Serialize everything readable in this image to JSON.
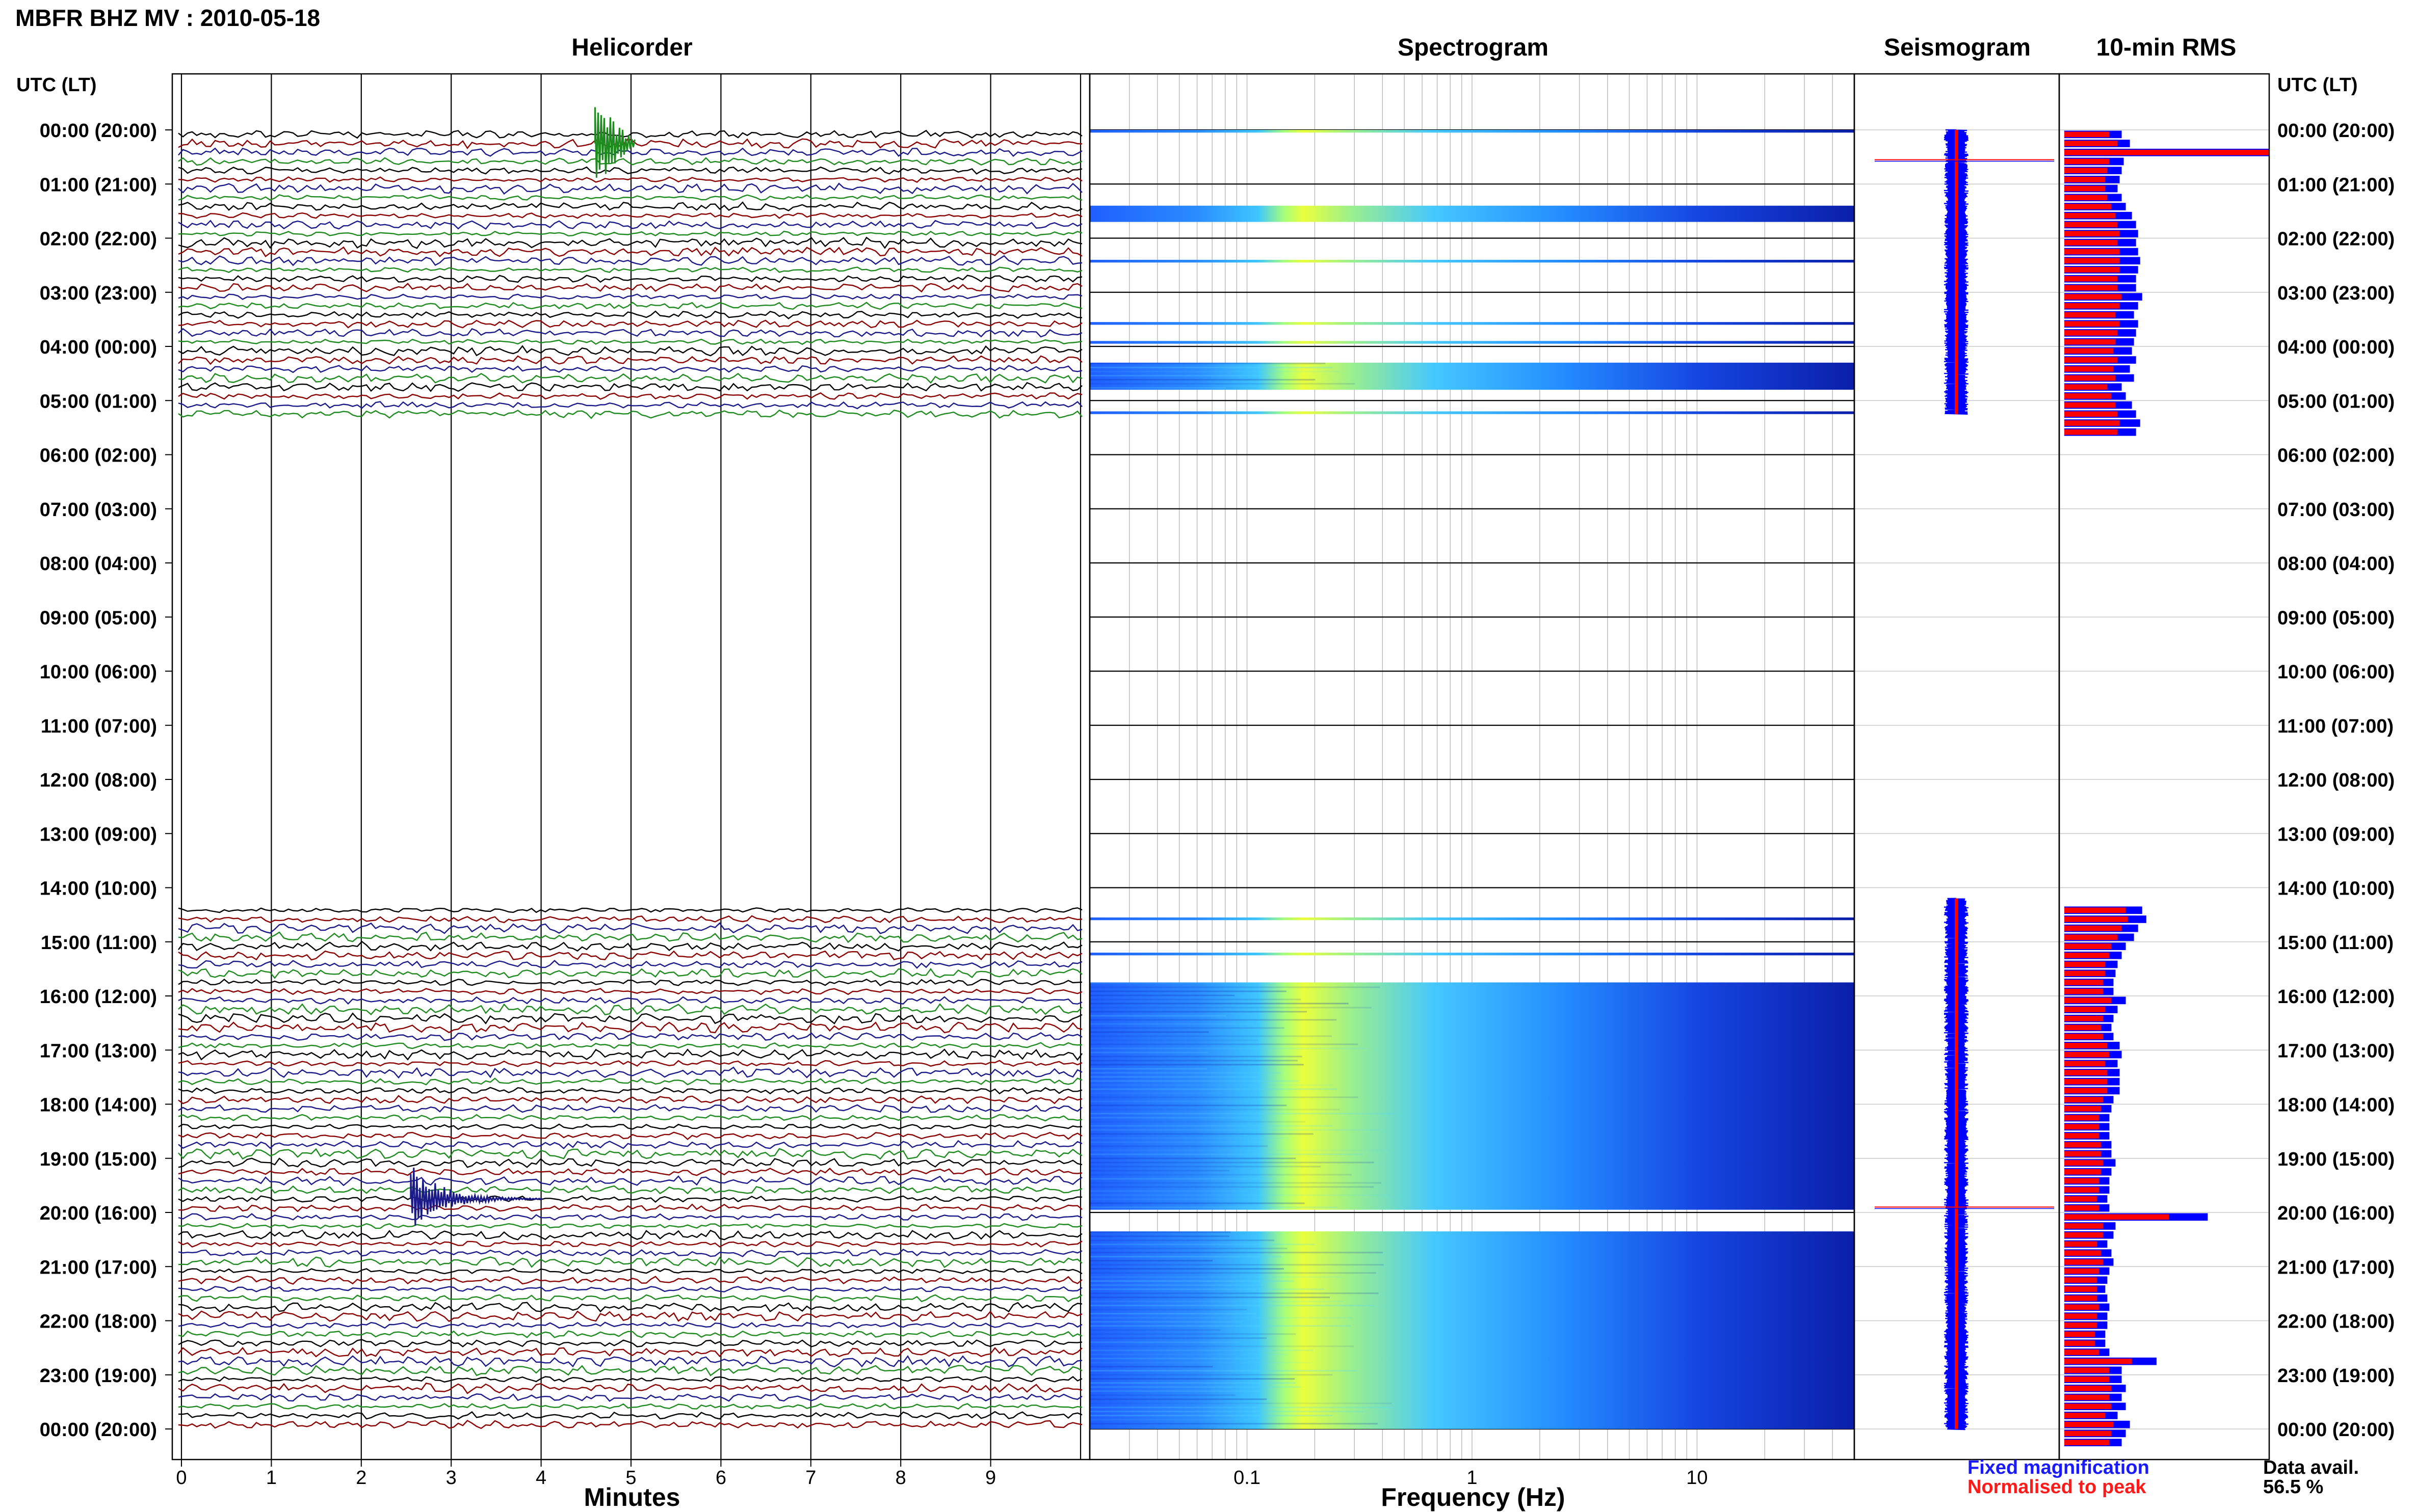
{
  "title": "MBFR BHZ MV : 2010-05-18",
  "panels": {
    "helicorder": "Helicorder",
    "spectrogram": "Spectrogram",
    "seismogram": "Seismogram",
    "rms": "10-min RMS"
  },
  "axis_titles": {
    "minutes": "Minutes",
    "frequency": "Frequency (Hz)"
  },
  "time_axis_label": "UTC (LT)",
  "legend": {
    "fixed": "Fixed magnification",
    "normalised": "Normalised to peak"
  },
  "data_availability": {
    "label": "Data avail.",
    "value": "56.5 %"
  },
  "colors": {
    "trace_cycle": [
      "#000000",
      "#8b0000",
      "#1a1a8b",
      "#1e8b1e"
    ],
    "fixed_magnification": "#0000ff",
    "normalised_to_peak": "#ff0000"
  },
  "chart_data": {
    "type": "line",
    "station": "MBFR",
    "channel": "BHZ",
    "network": "MV",
    "date": "2010-05-18",
    "time_ticks": [
      "00:00 (20:00)",
      "01:00 (21:00)",
      "02:00 (22:00)",
      "03:00 (23:00)",
      "04:00 (00:00)",
      "05:00 (01:00)",
      "06:00 (02:00)",
      "07:00 (03:00)",
      "08:00 (04:00)",
      "09:00 (05:00)",
      "10:00 (06:00)",
      "11:00 (07:00)",
      "12:00 (08:00)",
      "13:00 (09:00)",
      "14:00 (10:00)",
      "15:00 (11:00)",
      "16:00 (12:00)",
      "17:00 (13:00)",
      "18:00 (14:00)",
      "19:00 (15:00)",
      "20:00 (16:00)",
      "21:00 (17:00)",
      "22:00 (18:00)",
      "23:00 (19:00)",
      "00:00 (20:00)"
    ],
    "helicorder": {
      "x_ticks": [
        "0",
        "1",
        "2",
        "3",
        "4",
        "5",
        "6",
        "7",
        "8",
        "9"
      ],
      "xlim": [
        0,
        10
      ],
      "rows_per_hour": 6,
      "data_spans_utc_hours": [
        [
          0.0,
          5.25
        ],
        [
          14.2,
          24.0
        ]
      ],
      "events": [
        {
          "hour": 0.25,
          "minute": 4.6,
          "label": "burst"
        },
        {
          "hour": 19.75,
          "minute": 2.55,
          "label": "earthquake"
        }
      ]
    },
    "spectrogram": {
      "scale": "log",
      "xlim": [
        0.02,
        50
      ],
      "x_ticks": [
        "0.1",
        "1",
        "10"
      ],
      "data_spans_utc_hours": [
        [
          0.0,
          0.05
        ],
        [
          1.4,
          1.7
        ],
        [
          2.4,
          2.45
        ],
        [
          3.55,
          3.6
        ],
        [
          3.9,
          3.95
        ],
        [
          4.3,
          4.8
        ],
        [
          5.2,
          5.25
        ],
        [
          14.55,
          14.6
        ],
        [
          15.2,
          15.25
        ],
        [
          15.75,
          19.95
        ],
        [
          20.35,
          24.0
        ]
      ]
    },
    "seismogram": {
      "spikes_utc_hours": [
        0.55,
        19.9
      ]
    },
    "rms_10min": {
      "xlim": [
        0,
        100
      ],
      "series": [
        {
          "name": "Fixed magnification",
          "color": "#0000ff",
          "values": [
            28,
            32,
            100,
            29,
            28,
            27,
            26,
            28,
            30,
            33,
            35,
            36,
            35,
            36,
            37,
            36,
            35,
            35,
            38,
            36,
            34,
            36,
            35,
            34,
            33,
            35,
            32,
            34,
            28,
            30,
            33,
            35,
            37,
            35,
            0,
            0,
            0,
            0,
            0,
            0,
            0,
            0,
            0,
            0,
            0,
            0,
            0,
            0,
            0,
            0,
            0,
            0,
            0,
            0,
            0,
            0,
            0,
            0,
            0,
            0,
            0,
            0,
            0,
            0,
            0,
            0,
            0,
            0,
            0,
            0,
            0,
            0,
            0,
            0,
            0,
            0,
            0,
            0,
            0,
            0,
            0,
            0,
            0,
            0,
            0,
            0,
            38,
            40,
            36,
            34,
            30,
            28,
            26,
            25,
            24,
            24,
            30,
            26,
            24,
            23,
            24,
            27,
            28,
            26,
            27,
            27,
            27,
            24,
            23,
            22,
            22,
            22,
            23,
            23,
            25,
            23,
            22,
            22,
            21,
            22,
            70,
            25,
            24,
            21,
            23,
            24,
            22,
            21,
            20,
            21,
            22,
            21,
            21,
            20,
            20,
            22,
            45,
            28,
            28,
            30,
            28,
            30,
            26,
            32,
            30,
            28
          ]
        },
        {
          "name": "Normalised to peak",
          "color": "#ff0000",
          "values": [
            22,
            26,
            100,
            22,
            21,
            20,
            20,
            21,
            23,
            25,
            26,
            27,
            26,
            27,
            27,
            27,
            26,
            26,
            28,
            27,
            25,
            27,
            26,
            25,
            24,
            26,
            24,
            25,
            21,
            23,
            25,
            26,
            27,
            26,
            0,
            0,
            0,
            0,
            0,
            0,
            0,
            0,
            0,
            0,
            0,
            0,
            0,
            0,
            0,
            0,
            0,
            0,
            0,
            0,
            0,
            0,
            0,
            0,
            0,
            0,
            0,
            0,
            0,
            0,
            0,
            0,
            0,
            0,
            0,
            0,
            0,
            0,
            0,
            0,
            0,
            0,
            0,
            0,
            0,
            0,
            0,
            0,
            0,
            0,
            0,
            0,
            30,
            31,
            28,
            26,
            23,
            22,
            20,
            20,
            19,
            19,
            23,
            20,
            19,
            18,
            19,
            21,
            22,
            20,
            21,
            21,
            21,
            19,
            18,
            17,
            17,
            17,
            18,
            18,
            19,
            18,
            17,
            17,
            16,
            17,
            51,
            19,
            19,
            16,
            18,
            19,
            17,
            16,
            16,
            16,
            17,
            16,
            16,
            15,
            15,
            17,
            33,
            22,
            22,
            23,
            22,
            23,
            20,
            24,
            23,
            22
          ]
        }
      ]
    }
  }
}
